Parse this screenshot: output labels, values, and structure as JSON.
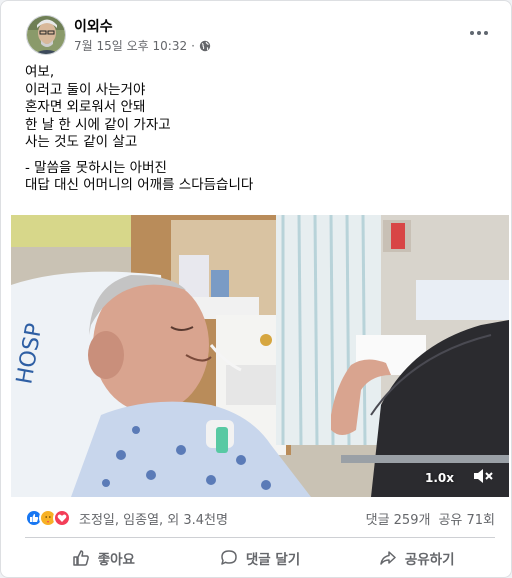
{
  "post": {
    "author": "이외수",
    "timestamp": "7월 15일 오후 10:32",
    "privacy_icon": "globe-icon",
    "lines": [
      "여보,",
      "이러고 둘이 사는거야",
      "혼자면 외로워서 안돼",
      "한 날 한 시에 같이 가자고",
      "사는 것도 같이 살고"
    ],
    "lines2": [
      "- 말씀을 못하시는 아버진",
      "대답 대신 어머니의 어깨를 스다듬습니다"
    ]
  },
  "video": {
    "speed_label": "1.0x",
    "mute_icon": "speaker-muted-icon"
  },
  "reactions": {
    "icons": [
      "like-icon",
      "care-icon",
      "love-icon"
    ],
    "reactors_text": "조정일, 임종열, 외 3.4천명",
    "comments_text": "댓글 259개",
    "shares_text": "공유 71회"
  },
  "actions": {
    "like_label": "좋아요",
    "comment_label": "댓글 달기",
    "share_label": "공유하기"
  },
  "colors": {
    "like_blue": "#1877f2",
    "love_red": "#f33e58",
    "care_yellow": "#f7b125",
    "secondary_text": "#65676b"
  }
}
